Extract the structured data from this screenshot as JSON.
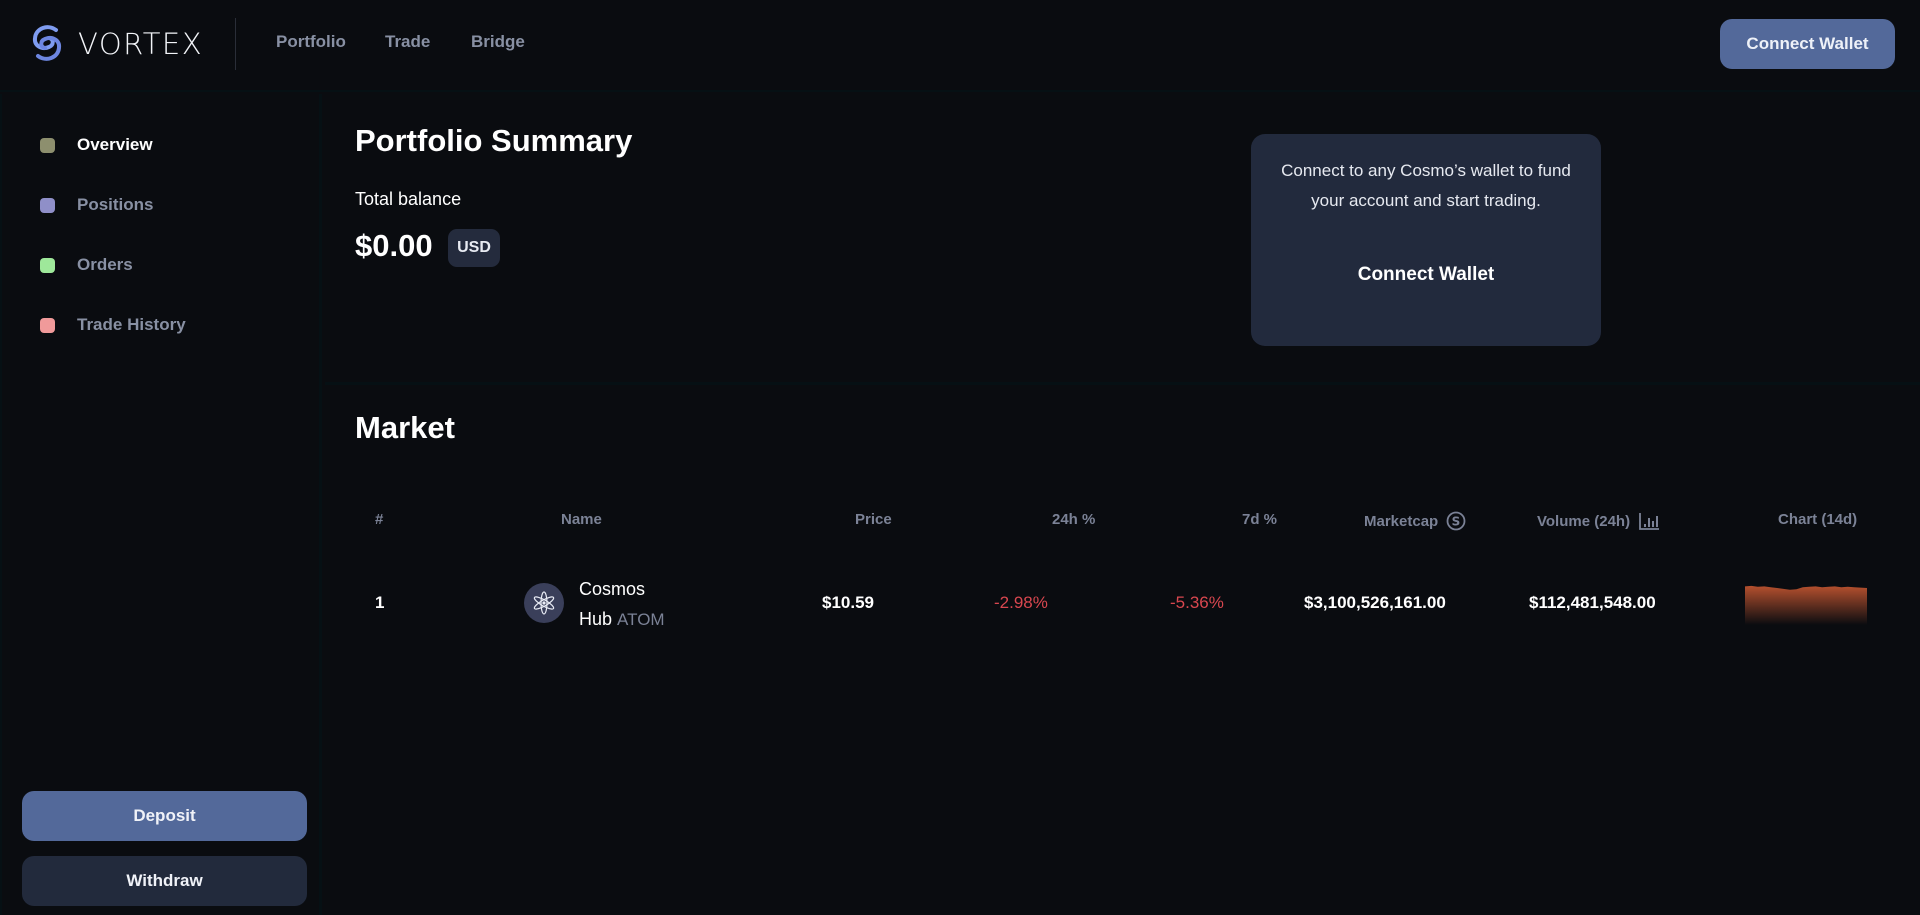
{
  "header": {
    "brand": "VORTEX",
    "nav": [
      {
        "label": "Portfolio"
      },
      {
        "label": "Trade"
      },
      {
        "label": "Bridge"
      }
    ],
    "connect_wallet_label": "Connect Wallet"
  },
  "sidebar": {
    "items": [
      {
        "label": "Overview",
        "color": "#8d8f6e",
        "active": true
      },
      {
        "label": "Positions",
        "color": "#8f8fc8",
        "active": false
      },
      {
        "label": "Orders",
        "color": "#9ee89a",
        "active": false
      },
      {
        "label": "Trade History",
        "color": "#f09a9a",
        "active": false
      }
    ],
    "deposit_label": "Deposit",
    "withdraw_label": "Withdraw"
  },
  "portfolio": {
    "title": "Portfolio Summary",
    "balance_label": "Total balance",
    "balance_value": "$0.00",
    "currency": "USD",
    "callout_text": "Connect to any Cosmo’s wallet to fund your account and start trading.",
    "callout_button": "Connect Wallet"
  },
  "market": {
    "title": "Market",
    "columns": {
      "rank": "#",
      "name": "Name",
      "price": "Price",
      "change_24h": "24h %",
      "change_7d": "7d %",
      "marketcap": "Marketcap",
      "volume": "Volume (24h)",
      "chart": "Chart (14d)"
    },
    "rows": [
      {
        "rank": "1",
        "name": "Cosmos Hub",
        "name_line1": "Cosmos",
        "name_line2": "Hub",
        "ticker": "ATOM",
        "price": "$10.59",
        "change_24h": "-2.98%",
        "change_7d": "-5.36%",
        "marketcap": "$3,100,526,161.00",
        "volume": "$112,481,548.00",
        "sparkline": [
          0.92,
          0.93,
          0.91,
          0.92,
          0.9,
          0.88,
          0.86,
          0.84,
          0.85,
          0.9,
          0.91,
          0.92,
          0.9,
          0.91,
          0.92,
          0.9,
          0.91,
          0.9,
          0.89,
          0.88
        ]
      }
    ]
  },
  "colors": {
    "accent": "#53699a",
    "negative": "#d8474f",
    "sparkline_fill": "#b5502e"
  }
}
